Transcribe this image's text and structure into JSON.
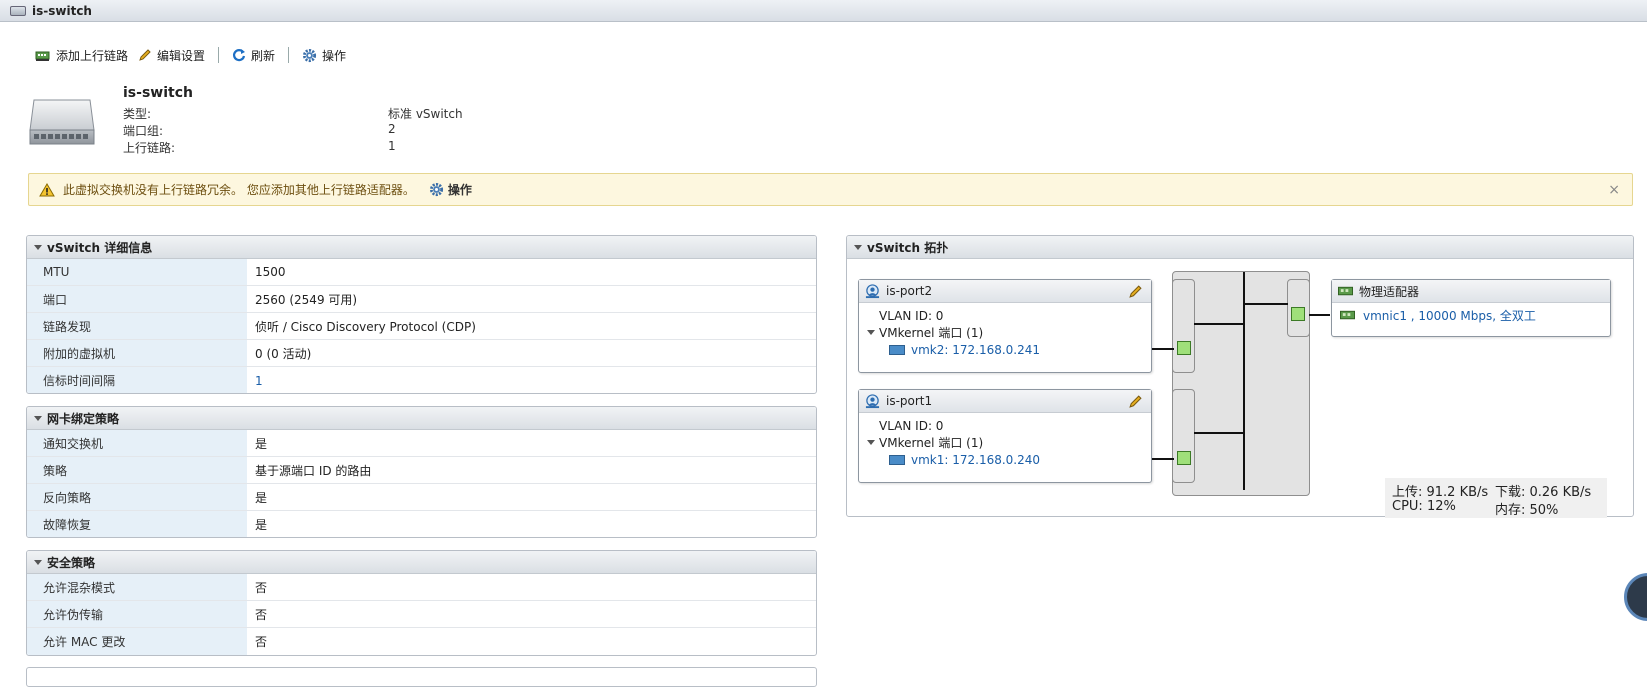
{
  "window": {
    "title": "is-switch"
  },
  "toolbar": {
    "add_uplink": "添加上行链路",
    "edit_settings": "编辑设置",
    "refresh": "刷新",
    "actions": "操作"
  },
  "summary": {
    "name": "is-switch",
    "rows": [
      {
        "label": "类型:",
        "value": "标准 vSwitch"
      },
      {
        "label": "端口组:",
        "value": "2"
      },
      {
        "label": "上行链路:",
        "value": "1"
      }
    ]
  },
  "alert": {
    "message": "此虚拟交换机没有上行链路冗余。 您应添加其他上行链路适配器。",
    "action": "操作",
    "close": "×"
  },
  "details": {
    "title": "vSwitch 详细信息",
    "rows": [
      {
        "label": "MTU",
        "value": "1500"
      },
      {
        "label": "端口",
        "value": "2560 (2549 可用)"
      },
      {
        "label": "链路发现",
        "value": "侦听 / Cisco Discovery Protocol (CDP)"
      },
      {
        "label": "附加的虚拟机",
        "value": "0 (0 活动)"
      },
      {
        "label": "信标时间间隔",
        "value": "1"
      }
    ]
  },
  "teaming": {
    "title": "网卡绑定策略",
    "rows": [
      {
        "label": "通知交换机",
        "value": "是"
      },
      {
        "label": "策略",
        "value": "基于源端口 ID 的路由"
      },
      {
        "label": "反向策略",
        "value": "是"
      },
      {
        "label": "故障恢复",
        "value": "是"
      }
    ]
  },
  "security": {
    "title": "安全策略",
    "rows": [
      {
        "label": "允许混杂模式",
        "value": "否"
      },
      {
        "label": "允许伪传输",
        "value": "否"
      },
      {
        "label": "允许 MAC 更改",
        "value": "否"
      }
    ]
  },
  "topology": {
    "title": "vSwitch 拓扑",
    "portgroups": [
      {
        "name": "is-port2",
        "vlan": "VLAN ID: 0",
        "vmk_group": "VMkernel 端口 (1)",
        "vmk": "vmk2: 172.168.0.241"
      },
      {
        "name": "is-port1",
        "vlan": "VLAN ID: 0",
        "vmk_group": "VMkernel 端口 (1)",
        "vmk": "vmk1: 172.168.0.240"
      }
    ],
    "physical": {
      "title": "物理适配器",
      "nic": "vmnic1 , 10000 Mbps, 全双工"
    }
  },
  "stats": {
    "upload": "上传: 91.2 KB/s",
    "download": "下载: 0.26 KB/s",
    "cpu": "CPU: 12%",
    "memory": "内存: 50%"
  },
  "colors": {
    "key_bg": "#e6f0f8",
    "link": "#1a5ea8",
    "alert_bg": "#fdf7df",
    "port_green": "#9fe07a"
  }
}
